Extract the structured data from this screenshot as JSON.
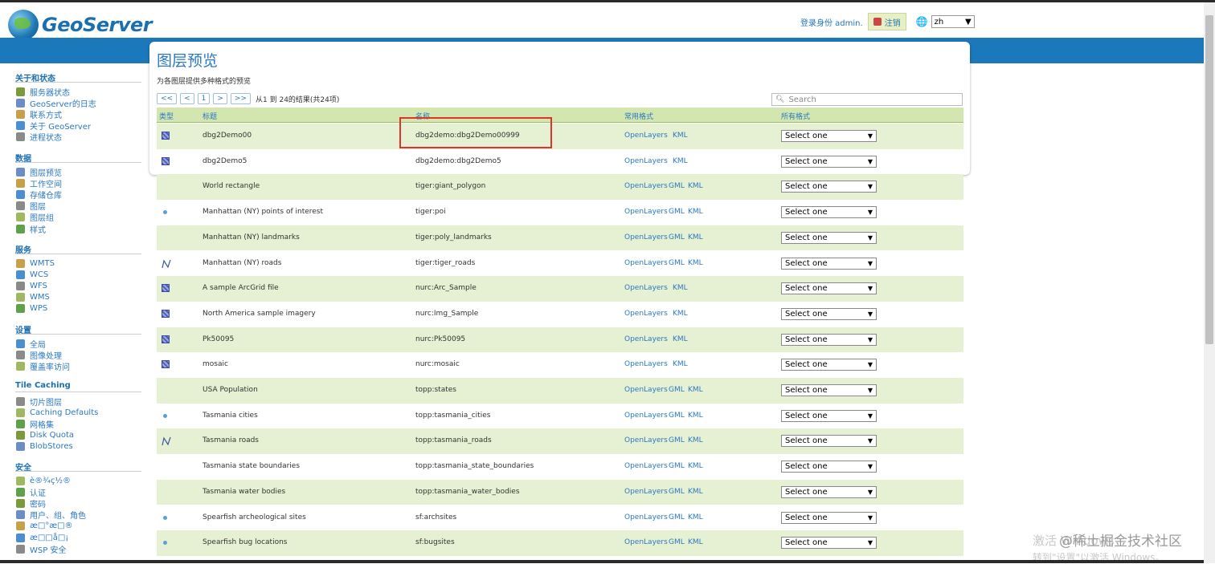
{
  "header": {
    "logo_text": "GeoServer",
    "logged_in_as": "登录身份 admin.",
    "logout_label": "注销",
    "language": "zh"
  },
  "sidebar": {
    "sections": [
      {
        "title": "关于和状态",
        "items": [
          {
            "label": "服务器状态",
            "icon": "server-status-icon"
          },
          {
            "label": "GeoServer的日志",
            "icon": "log-icon"
          },
          {
            "label": "联系方式",
            "icon": "contact-icon"
          },
          {
            "label": "关于 GeoServer",
            "icon": "about-icon"
          },
          {
            "label": "进程状态",
            "icon": "process-icon"
          }
        ]
      },
      {
        "title": "数据",
        "items": [
          {
            "label": "图层预览",
            "icon": "layer-preview-icon"
          },
          {
            "label": "工作空间",
            "icon": "workspace-icon"
          },
          {
            "label": "存储仓库",
            "icon": "store-icon"
          },
          {
            "label": "图层",
            "icon": "layers-icon"
          },
          {
            "label": "图层组",
            "icon": "layergroup-icon"
          },
          {
            "label": "样式",
            "icon": "styles-icon"
          }
        ]
      },
      {
        "title": "服务",
        "items": [
          {
            "label": "WMTS",
            "icon": "service-icon"
          },
          {
            "label": "WCS",
            "icon": "service-icon"
          },
          {
            "label": "WFS",
            "icon": "service-icon"
          },
          {
            "label": "WMS",
            "icon": "service-icon"
          },
          {
            "label": "WPS",
            "icon": "service-icon"
          }
        ]
      },
      {
        "title": "设置",
        "items": [
          {
            "label": "全局",
            "icon": "global-icon"
          },
          {
            "label": "图像处理",
            "icon": "image-processing-icon"
          },
          {
            "label": "覆盖率访问",
            "icon": "coverage-icon"
          }
        ]
      },
      {
        "title": "Tile Caching",
        "items": [
          {
            "label": "切片图层",
            "icon": "tile-layers-icon"
          },
          {
            "label": "Caching Defaults",
            "icon": "caching-icon"
          },
          {
            "label": "网格集",
            "icon": "gridset-icon"
          },
          {
            "label": "Disk Quota",
            "icon": "disk-icon"
          },
          {
            "label": "BlobStores",
            "icon": "blob-icon"
          }
        ]
      },
      {
        "title": "安全",
        "items": [
          {
            "label": "è®¾ç½®",
            "icon": "key-icon"
          },
          {
            "label": "认证",
            "icon": "shield-icon"
          },
          {
            "label": "密码",
            "icon": "lock-icon"
          },
          {
            "label": "用户、组、角色",
            "icon": "users-icon"
          },
          {
            "label": "æ□°æ□®",
            "icon": "data-sec-icon"
          },
          {
            "label": "æ□□å□¡",
            "icon": "service-sec-icon"
          },
          {
            "label": "WSP 安全",
            "icon": "wsp-icon"
          }
        ]
      }
    ]
  },
  "page": {
    "title": "图层预览",
    "description": "为各图层提供多种格式的预览",
    "pager": {
      "first": "<<",
      "prev": "<",
      "page": "1",
      "next": ">",
      "last": ">>",
      "results": "从1 到 24的结果(共24项)"
    },
    "search_placeholder": "Search"
  },
  "table": {
    "headers": {
      "type": "类型",
      "title": "标题",
      "name": "名称",
      "common": "常用格式",
      "all": "所有格式"
    },
    "select_label": "Select one",
    "rows": [
      {
        "type": "raster",
        "title": "dbg2Demo00",
        "name": "dbg2demo:dbg2Demo00999",
        "formats": [
          "OpenLayers",
          "KML"
        ]
      },
      {
        "type": "raster",
        "title": "dbg2Demo5",
        "name": "dbg2demo:dbg2Demo5",
        "formats": [
          "OpenLayers",
          "KML"
        ]
      },
      {
        "type": "polygon",
        "title": "World rectangle",
        "name": "tiger:giant_polygon",
        "formats": [
          "OpenLayers",
          "GML",
          "KML"
        ]
      },
      {
        "type": "point",
        "title": "Manhattan (NY) points of interest",
        "name": "tiger:poi",
        "formats": [
          "OpenLayers",
          "GML",
          "KML"
        ]
      },
      {
        "type": "polygon",
        "title": "Manhattan (NY) landmarks",
        "name": "tiger:poly_landmarks",
        "formats": [
          "OpenLayers",
          "GML",
          "KML"
        ]
      },
      {
        "type": "line",
        "title": "Manhattan (NY) roads",
        "name": "tiger:tiger_roads",
        "formats": [
          "OpenLayers",
          "GML",
          "KML"
        ]
      },
      {
        "type": "raster",
        "title": "A sample ArcGrid file",
        "name": "nurc:Arc_Sample",
        "formats": [
          "OpenLayers",
          "KML"
        ]
      },
      {
        "type": "raster",
        "title": "North America sample imagery",
        "name": "nurc:Img_Sample",
        "formats": [
          "OpenLayers",
          "KML"
        ]
      },
      {
        "type": "raster",
        "title": "Pk50095",
        "name": "nurc:Pk50095",
        "formats": [
          "OpenLayers",
          "KML"
        ]
      },
      {
        "type": "raster",
        "title": "mosaic",
        "name": "nurc:mosaic",
        "formats": [
          "OpenLayers",
          "KML"
        ]
      },
      {
        "type": "polygon",
        "title": "USA Population",
        "name": "topp:states",
        "formats": [
          "OpenLayers",
          "GML",
          "KML"
        ]
      },
      {
        "type": "point",
        "title": "Tasmania cities",
        "name": "topp:tasmania_cities",
        "formats": [
          "OpenLayers",
          "GML",
          "KML"
        ]
      },
      {
        "type": "line",
        "title": "Tasmania roads",
        "name": "topp:tasmania_roads",
        "formats": [
          "OpenLayers",
          "GML",
          "KML"
        ]
      },
      {
        "type": "polygon",
        "title": "Tasmania state boundaries",
        "name": "topp:tasmania_state_boundaries",
        "formats": [
          "OpenLayers",
          "GML",
          "KML"
        ]
      },
      {
        "type": "polygon",
        "title": "Tasmania water bodies",
        "name": "topp:tasmania_water_bodies",
        "formats": [
          "OpenLayers",
          "GML",
          "KML"
        ]
      },
      {
        "type": "point",
        "title": "Spearfish archeological sites",
        "name": "sf:archsites",
        "formats": [
          "OpenLayers",
          "GML",
          "KML"
        ]
      },
      {
        "type": "point",
        "title": "Spearfish bug locations",
        "name": "sf:bugsites",
        "formats": [
          "OpenLayers",
          "GML",
          "KML"
        ]
      }
    ]
  },
  "watermark": {
    "line1": "激活 Windows",
    "line2": "转到\"设置\"以激活 Windows。",
    "site": "@稀土掘金技术社区"
  }
}
